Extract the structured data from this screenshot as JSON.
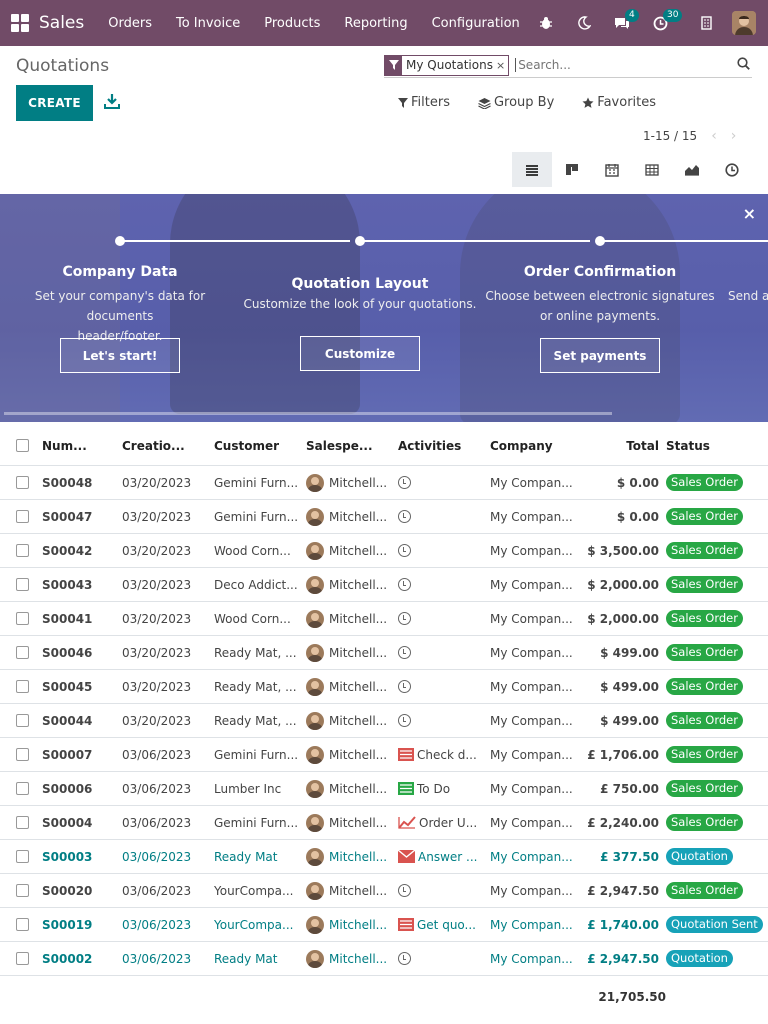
{
  "nav": {
    "app_name": "Sales",
    "menu": [
      "Orders",
      "To Invoice",
      "Products",
      "Reporting",
      "Configuration"
    ],
    "chat_count": "4",
    "activity_count": "30"
  },
  "control": {
    "title": "Quotations",
    "create_label": "CREATE",
    "facet_label": "My Quotations",
    "facet_close": "×",
    "search_placeholder": "Search...",
    "filters_label": "Filters",
    "groupby_label": "Group By",
    "favorites_label": "Favorites",
    "pager_text": "1-15 / 15",
    "pager_prev": "‹",
    "pager_next": "›"
  },
  "banner": {
    "close": "×",
    "steps": [
      {
        "title": "Company Data",
        "desc1": "Set your company's data for documents",
        "desc2": "header/footer.",
        "button": "Let's start!"
      },
      {
        "title": "Quotation Layout",
        "desc1": "Customize the look of your quotations.",
        "desc2": "",
        "button": "Customize"
      },
      {
        "title": "Order Confirmation",
        "desc1": "Choose between electronic signatures",
        "desc2": "or online payments.",
        "button": "Set payments"
      },
      {
        "title": "",
        "desc1": "Send a",
        "desc2": "",
        "button": ""
      }
    ]
  },
  "table": {
    "headers": {
      "number": "Num...",
      "creation": "Creatio...",
      "customer": "Customer",
      "salesperson": "Salespe...",
      "activities": "Activities",
      "company": "Company",
      "total": "Total",
      "status": "Status"
    },
    "rows": [
      {
        "number": "S00048",
        "date": "03/20/2023",
        "customer": "Gemini Furn...",
        "salesperson": "Mitchell...",
        "activity": "",
        "activity_type": "clock",
        "company": "My Compan...",
        "total": "$ 0.00",
        "status": "Sales Order",
        "status_color": "green",
        "link": false
      },
      {
        "number": "S00047",
        "date": "03/20/2023",
        "customer": "Gemini Furn...",
        "salesperson": "Mitchell...",
        "activity": "",
        "activity_type": "clock",
        "company": "My Compan...",
        "total": "$ 0.00",
        "status": "Sales Order",
        "status_color": "green",
        "link": false
      },
      {
        "number": "S00042",
        "date": "03/20/2023",
        "customer": "Wood Corn...",
        "salesperson": "Mitchell...",
        "activity": "",
        "activity_type": "clock",
        "company": "My Compan...",
        "total": "$ 3,500.00",
        "status": "Sales Order",
        "status_color": "green",
        "link": false
      },
      {
        "number": "S00043",
        "date": "03/20/2023",
        "customer": "Deco Addict...",
        "salesperson": "Mitchell...",
        "activity": "",
        "activity_type": "clock",
        "company": "My Compan...",
        "total": "$ 2,000.00",
        "status": "Sales Order",
        "status_color": "green",
        "link": false
      },
      {
        "number": "S00041",
        "date": "03/20/2023",
        "customer": "Wood Corn...",
        "salesperson": "Mitchell...",
        "activity": "",
        "activity_type": "clock",
        "company": "My Compan...",
        "total": "$ 2,000.00",
        "status": "Sales Order",
        "status_color": "green",
        "link": false
      },
      {
        "number": "S00046",
        "date": "03/20/2023",
        "customer": "Ready Mat, ...",
        "salesperson": "Mitchell...",
        "activity": "",
        "activity_type": "clock",
        "company": "My Compan...",
        "total": "$ 499.00",
        "status": "Sales Order",
        "status_color": "green",
        "link": false
      },
      {
        "number": "S00045",
        "date": "03/20/2023",
        "customer": "Ready Mat, ...",
        "salesperson": "Mitchell...",
        "activity": "",
        "activity_type": "clock",
        "company": "My Compan...",
        "total": "$ 499.00",
        "status": "Sales Order",
        "status_color": "green",
        "link": false
      },
      {
        "number": "S00044",
        "date": "03/20/2023",
        "customer": "Ready Mat, ...",
        "salesperson": "Mitchell...",
        "activity": "",
        "activity_type": "clock",
        "company": "My Compan...",
        "total": "$ 499.00",
        "status": "Sales Order",
        "status_color": "green",
        "link": false
      },
      {
        "number": "S00007",
        "date": "03/06/2023",
        "customer": "Gemini Furn...",
        "salesperson": "Mitchell...",
        "activity": "Check d...",
        "activity_type": "red-list",
        "company": "My Compan...",
        "total": "£ 1,706.00",
        "status": "Sales Order",
        "status_color": "green",
        "link": false
      },
      {
        "number": "S00006",
        "date": "03/06/2023",
        "customer": "Lumber Inc",
        "salesperson": "Mitchell...",
        "activity": "To Do",
        "activity_type": "green-list",
        "company": "My Compan...",
        "total": "£ 750.00",
        "status": "Sales Order",
        "status_color": "green",
        "link": false
      },
      {
        "number": "S00004",
        "date": "03/06/2023",
        "customer": "Gemini Furn...",
        "salesperson": "Mitchell...",
        "activity": "Order U...",
        "activity_type": "red-chart",
        "company": "My Compan...",
        "total": "£ 2,240.00",
        "status": "Sales Order",
        "status_color": "green",
        "link": false
      },
      {
        "number": "S00003",
        "date": "03/06/2023",
        "customer": "Ready Mat",
        "salesperson": "Mitchell...",
        "activity": "Answer ...",
        "activity_type": "red-mail",
        "company": "My Compan...",
        "total": "£ 377.50",
        "status": "Quotation",
        "status_color": "teal",
        "link": true
      },
      {
        "number": "S00020",
        "date": "03/06/2023",
        "customer": "YourCompa...",
        "salesperson": "Mitchell...",
        "activity": "",
        "activity_type": "clock",
        "company": "My Compan...",
        "total": "£ 2,947.50",
        "status": "Sales Order",
        "status_color": "green",
        "link": false
      },
      {
        "number": "S00019",
        "date": "03/06/2023",
        "customer": "YourCompa...",
        "salesperson": "Mitchell...",
        "activity": "Get quo...",
        "activity_type": "red-list",
        "company": "My Compan...",
        "total": "£ 1,740.00",
        "status": "Quotation Sent",
        "status_color": "teal",
        "link": true
      },
      {
        "number": "S00002",
        "date": "03/06/2023",
        "customer": "Ready Mat",
        "salesperson": "Mitchell...",
        "activity": "",
        "activity_type": "clock",
        "company": "My Compan...",
        "total": "£ 2,947.50",
        "status": "Quotation",
        "status_color": "teal",
        "link": true
      }
    ],
    "grand_total": "21,705.50"
  }
}
